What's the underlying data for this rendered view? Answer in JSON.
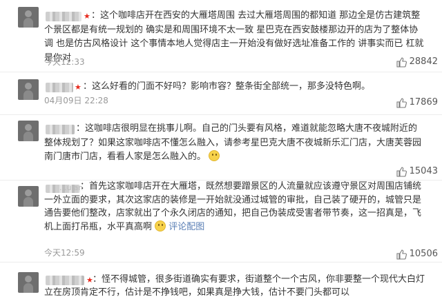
{
  "comments": [
    {
      "text": "这个咖啡店开在西安的大雁塔周围  去过大雁塔周围的都知道  那边全是仿古建筑整个景区都是有统一规划的  确实是和周围环境不太一致  星巴克在西安鼓楼那边开的店为了整体协调  也是仿古风格设计  这个事情本地人觉得店主一开始没有做好选址准备工作的  讲事实而已  杠就是你对",
      "time": "今天12:33",
      "likes": "28842",
      "vip": true
    },
    {
      "text": "这么好看的门面不好吗？影响市容？整条街全部统一，那多没特色啊。",
      "time": "04月09日 22:28",
      "likes": "17869",
      "vip": true
    },
    {
      "text": "这咖啡店很明显在挑事儿啊。自己的门头要有风格，难道就能忽略大唐不夜城附近的整体规划了？如果这家咖啡店不懂怎么融入，请参考星巴克大唐不夜城新乐汇门店，大唐芙蓉园南门唐市门店，看看人家是怎么融入的。",
      "likes": "15043",
      "vip": false
    },
    {
      "name_partial": "...ulan",
      "text": "首先这家咖啡店开在大雁塔，既然想要蹭景区的人流量就应该遵守景区对周围店铺统一外立面的要求，其次这家店的装修是一开始就没通过城管的审批，自己装了硬开的，城管只是通告要他们整改，店家就出了个永久闭店的通知，把自己伪装成受害者带节奏，这一招真是，飞机上面打吊瓶，水平真高啊",
      "link": "评论配图",
      "time": "今天12:59",
      "likes": "10506",
      "vip": false
    },
    {
      "text": "怪不得城管，很多街道确实有要求，街道整个一个古风，你非要整一个现代大白灯立在房顶肯定不行，估计是不挣钱吧，如果真是挣大钱，估计不要门头都可以",
      "vip": true
    }
  ],
  "colors": {
    "text": "#333333",
    "meta": "#999999",
    "vip": "#e8291c",
    "link": "#5a7fb5"
  },
  "icons": {
    "vip": "vip-star-icon",
    "like": "thumbs-up-icon",
    "emoji": "smile-emoji-icon"
  }
}
